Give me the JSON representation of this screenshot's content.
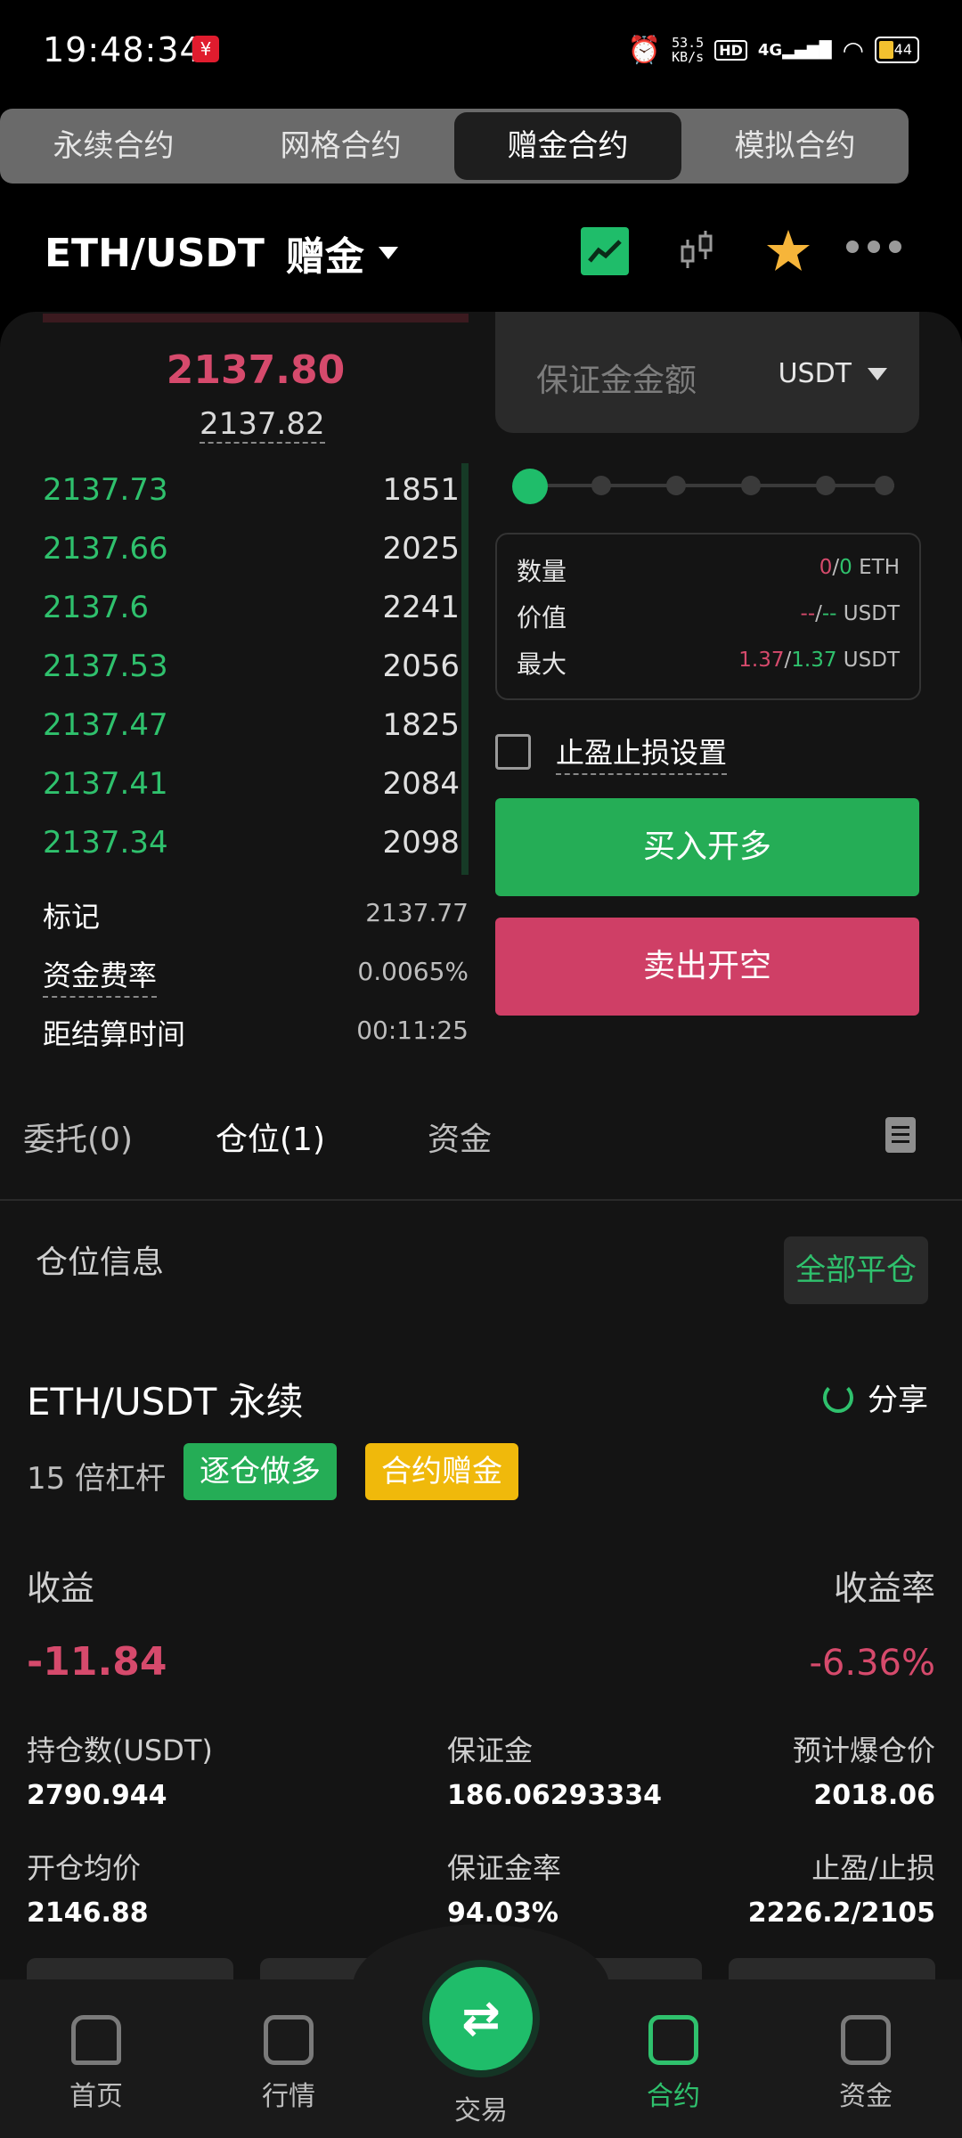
{
  "status": {
    "time": "19:48:34",
    "net_speed": "53.5",
    "net_unit": "KB/s",
    "hd": "HD",
    "signal": "4G",
    "battery": "44"
  },
  "contract_tabs": [
    "永续合约",
    "网格合约",
    "赠金合约",
    "模拟合约"
  ],
  "header": {
    "pair": "ETH/USDT",
    "mode": "赠金"
  },
  "price": {
    "last": "2137.80",
    "mark": "2137.82"
  },
  "orderbook": [
    {
      "price": "2137.73",
      "qty": "1851"
    },
    {
      "price": "2137.66",
      "qty": "2025"
    },
    {
      "price": "2137.6",
      "qty": "2241"
    },
    {
      "price": "2137.53",
      "qty": "2056"
    },
    {
      "price": "2137.47",
      "qty": "1825"
    },
    {
      "price": "2137.41",
      "qty": "2084"
    },
    {
      "price": "2137.34",
      "qty": "2098"
    }
  ],
  "market_info": {
    "mark_label": "标记",
    "mark_value": "2137.77",
    "funding_label": "资金费率",
    "funding_value": "0.0065%",
    "settle_label": "距结算时间",
    "settle_value": "00:11:25"
  },
  "order_form": {
    "margin_placeholder": "保证金金额",
    "margin_unit": "USDT",
    "slider_level": 0,
    "qty_label": "数量",
    "qty_a": "0",
    "qty_b": "0",
    "qty_unit": "ETH",
    "value_label": "价值",
    "value_a": "--",
    "value_b": "--",
    "value_unit": "USDT",
    "max_label": "最大",
    "max_a": "1.37",
    "max_b": "1.37",
    "max_unit": "USDT",
    "slash": "/",
    "tpsl_label": "止盈止损设置",
    "buy_label": "买入开多",
    "sell_label": "卖出开空"
  },
  "lower_tabs": {
    "orders": "委托(0)",
    "positions": "仓位(1)",
    "funds": "资金"
  },
  "positions": {
    "section_title": "仓位信息",
    "close_all": "全部平仓",
    "title": "ETH/USDT 永续",
    "share": "分享",
    "leverage": "15 倍杠杆",
    "tag1": "逐仓做多",
    "tag2": "合约赠金",
    "pnl_label": "收益",
    "pnl_value": "-11.84",
    "roe_label": "收益率",
    "roe_value": "-6.36%",
    "size_label": "持仓数(USDT)",
    "size_value": "2790.944",
    "margin_label": "保证金",
    "margin_value": "186.06293334",
    "liq_label": "预计爆仓价",
    "liq_value": "2018.06",
    "entry_label": "开仓均价",
    "entry_value": "2146.88",
    "mratio_label": "保证金率",
    "mratio_value": "94.03%",
    "tpsl_label": "止盈/止损",
    "tpsl_value": "2226.2/2105"
  },
  "nav": {
    "home": "首页",
    "market": "行情",
    "trade": "交易",
    "contract": "合约",
    "funds": "资金",
    "trade_icon": "⇄"
  },
  "colors": {
    "green": "#2fc16d",
    "red": "#d64a6c",
    "buy": "#25ad56",
    "sell": "#cf3f66",
    "gold": "#f0b90b"
  },
  "icons": [
    "line-chart-icon",
    "candlestick-icon",
    "star-icon",
    "more-icon",
    "share-icon",
    "list-icon",
    "home-icon",
    "market-icon",
    "trade-icon",
    "contract-icon",
    "wallet-icon"
  ]
}
